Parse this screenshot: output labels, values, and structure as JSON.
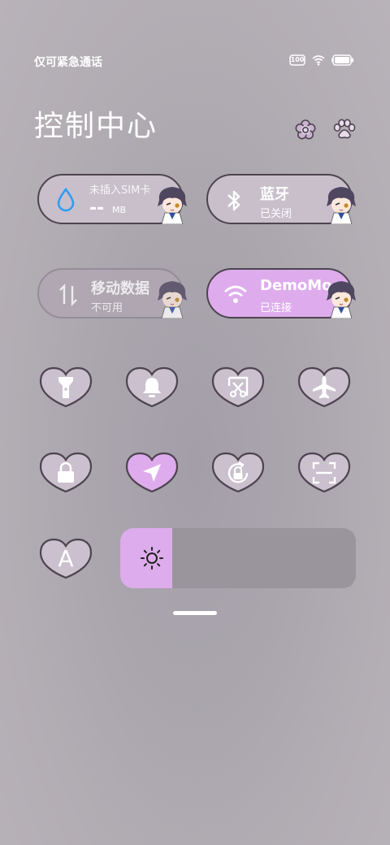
{
  "status_bar": {
    "carrier_text": "仅可紧急通话",
    "icons": [
      "battery-charging-icon",
      "wifi-icon",
      "battery-icon"
    ],
    "battery_badge": "100"
  },
  "title": "控制中心",
  "header_buttons": [
    "settings-flower-icon",
    "paw-icon"
  ],
  "tiles": {
    "data_usage": {
      "label": "未插入SIM卡",
      "value": "--",
      "unit": "MB",
      "icon": "water-drop-icon"
    },
    "bluetooth": {
      "label": "蓝牙",
      "status": "已关闭",
      "icon": "bluetooth-icon"
    },
    "mobile_data": {
      "label": "移动数据",
      "status": "不可用",
      "icon": "data-arrows-icon"
    },
    "wifi": {
      "label": "DemoMoc",
      "status": "已连接",
      "icon": "wifi-icon"
    }
  },
  "toggles": [
    {
      "name": "flashlight",
      "icon": "flashlight-icon",
      "active": false
    },
    {
      "name": "ring",
      "icon": "bell-icon",
      "active": false
    },
    {
      "name": "screenshot",
      "icon": "screenshot-scissors-icon",
      "active": false
    },
    {
      "name": "airplane",
      "icon": "airplane-icon",
      "active": false
    },
    {
      "name": "lock-screen",
      "icon": "lock-icon",
      "active": false
    },
    {
      "name": "location",
      "icon": "location-arrow-icon",
      "active": true
    },
    {
      "name": "auto-rotate",
      "icon": "rotate-lock-icon",
      "active": false
    },
    {
      "name": "scanner",
      "icon": "scan-icon",
      "active": false
    },
    {
      "name": "font-size",
      "icon": "font-a-icon",
      "active": false,
      "label": "A"
    }
  ],
  "brightness": {
    "level": 0.22,
    "icon": "sun-icon"
  },
  "colors": {
    "active": "#deaced",
    "tile": "#c8bfcb",
    "outline": "#4d4450"
  }
}
